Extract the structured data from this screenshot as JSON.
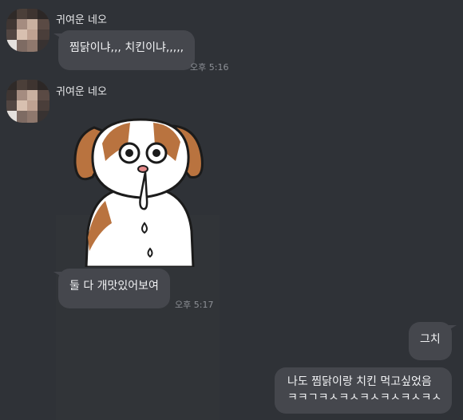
{
  "messages": [
    {
      "sender": "귀여운 네오",
      "text": "찜닭이냐,,, 치킨이냐,,,,,",
      "time": "오후 5:16"
    },
    {
      "sender": "귀여운 네오",
      "sticker": "dog-drooling-sticker",
      "text": "둘 다 개맛있어보여",
      "time": "오후 5:17"
    }
  ],
  "my_messages": [
    {
      "text": "그치"
    },
    {
      "line1": "나도 찜닭이랑 치킨 먹고싶었음",
      "line2": "ㅋㅋㄱㅋㅅㅋㅅㅋㅅㅋㅅㅋㅅㅋㅅ"
    }
  ],
  "colors": {
    "background": "#2f3237",
    "bubble": "#45474d",
    "text": "#f1f2f4",
    "time": "#8d9096"
  }
}
